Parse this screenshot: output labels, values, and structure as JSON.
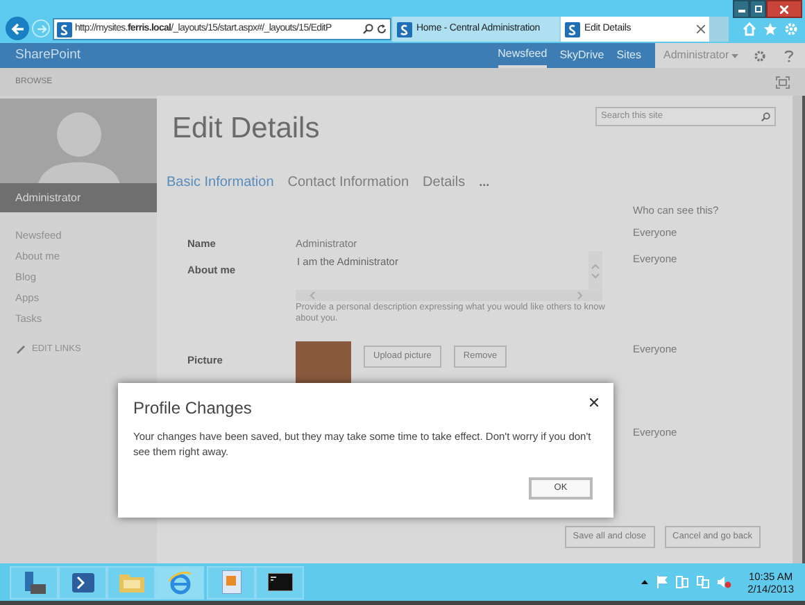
{
  "browser": {
    "address": "http://mysites.**ferris.local**/_layouts/15/start.aspx#/_layouts/15/EditP",
    "tabs": [
      {
        "label": "Home - Central Administration",
        "selected": false
      },
      {
        "label": "Edit Details",
        "selected": true
      }
    ]
  },
  "suite_bar": {
    "brand": "SharePoint",
    "links": [
      {
        "label": "Newsfeed",
        "selected": true
      },
      {
        "label": "SkyDrive",
        "selected": false
      },
      {
        "label": "Sites",
        "selected": false
      }
    ],
    "user": "Administrator"
  },
  "ribbon": {
    "tab": "BROWSE"
  },
  "profile": {
    "name": "Administrator"
  },
  "nav": {
    "items": [
      "Newsfeed",
      "About me",
      "Blog",
      "Apps",
      "Tasks"
    ],
    "edit_links": "EDIT LINKS"
  },
  "search": {
    "placeholder": "Search this site"
  },
  "page_title": "Edit Details",
  "tabs": [
    {
      "label": "Basic Information",
      "selected": true
    },
    {
      "label": "Contact Information",
      "selected": false
    },
    {
      "label": "Details",
      "selected": false
    }
  ],
  "more_tabs": "...",
  "visibility_header": "Who can see this?",
  "fields": [
    {
      "kind": "text",
      "label": "Name",
      "value": "Administrator",
      "visibility": "Everyone"
    },
    {
      "kind": "textarea",
      "label": "About me",
      "value": "I am the Administrator",
      "hint": "Provide a personal description expressing what you would like others to know about you.",
      "visibility": "Everyone"
    },
    {
      "kind": "picture",
      "label": "Picture",
      "buttons": [
        "Upload picture",
        "Remove"
      ],
      "visibility": "Everyone"
    },
    {
      "kind": "covered",
      "visibility": "Everyone"
    }
  ],
  "actions": [
    "Save all and close",
    "Cancel and go back"
  ],
  "dialog": {
    "title": "Profile Changes",
    "message": "Your changes have been saved, but they may take some time to take effect. Don't worry if you don't see them right away.",
    "button": "OK"
  },
  "taskbar": {
    "time": "10:35 AM",
    "date": "2/14/2013"
  }
}
